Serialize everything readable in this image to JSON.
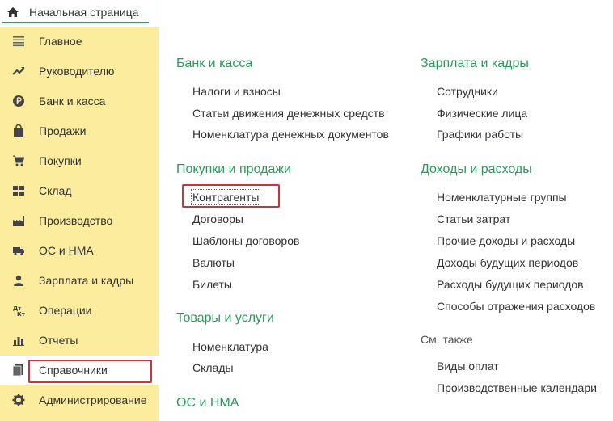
{
  "tab": {
    "label": "Начальная страница"
  },
  "sidebar": {
    "items": [
      {
        "label": "Главное",
        "icon": "menu-lines-icon"
      },
      {
        "label": "Руководителю",
        "icon": "trend-chart-icon"
      },
      {
        "label": "Банк и касса",
        "icon": "ruble-coin-icon"
      },
      {
        "label": "Продажи",
        "icon": "shopping-bag-icon"
      },
      {
        "label": "Покупки",
        "icon": "shopping-cart-icon"
      },
      {
        "label": "Склад",
        "icon": "warehouse-grid-icon"
      },
      {
        "label": "Производство",
        "icon": "factory-icon"
      },
      {
        "label": "ОС и НМА",
        "icon": "truck-icon"
      },
      {
        "label": "Зарплата и кадры",
        "icon": "person-icon"
      },
      {
        "label": "Операции",
        "icon": "debit-credit-icon"
      },
      {
        "label": "Отчеты",
        "icon": "bar-chart-icon"
      },
      {
        "label": "Справочники",
        "icon": "books-icon",
        "active": true
      },
      {
        "label": "Администрирование",
        "icon": "gear-icon"
      }
    ]
  },
  "sections": {
    "bank": {
      "title": "Банк и касса",
      "links": [
        "Налоги и взносы",
        "Статьи движения денежных средств",
        "Номенклатура денежных документов"
      ]
    },
    "purchases": {
      "title": "Покупки и продажи",
      "links": [
        "Контрагенты",
        "Договоры",
        "Шаблоны договоров",
        "Валюты",
        "Билеты"
      ]
    },
    "goods": {
      "title": "Товары и услуги",
      "links": [
        "Номенклатура",
        "Склады"
      ]
    },
    "os": {
      "title": "ОС и НМА"
    },
    "salary": {
      "title": "Зарплата и кадры",
      "links": [
        "Сотрудники",
        "Физические лица",
        "Графики работы"
      ]
    },
    "income": {
      "title": "Доходы и расходы",
      "links": [
        "Номенклатурные группы",
        "Статьи затрат",
        "Прочие доходы и расходы",
        "Доходы будущих периодов",
        "Расходы будущих периодов",
        "Способы отражения расходов"
      ]
    },
    "see_also": {
      "title": "См. также",
      "links": [
        "Виды оплат",
        "Производственные календари"
      ]
    }
  },
  "colors": {
    "sidebar_bg": "#fbec9e",
    "section_green": "#2c9a5b",
    "highlight_red": "#c9343d"
  }
}
